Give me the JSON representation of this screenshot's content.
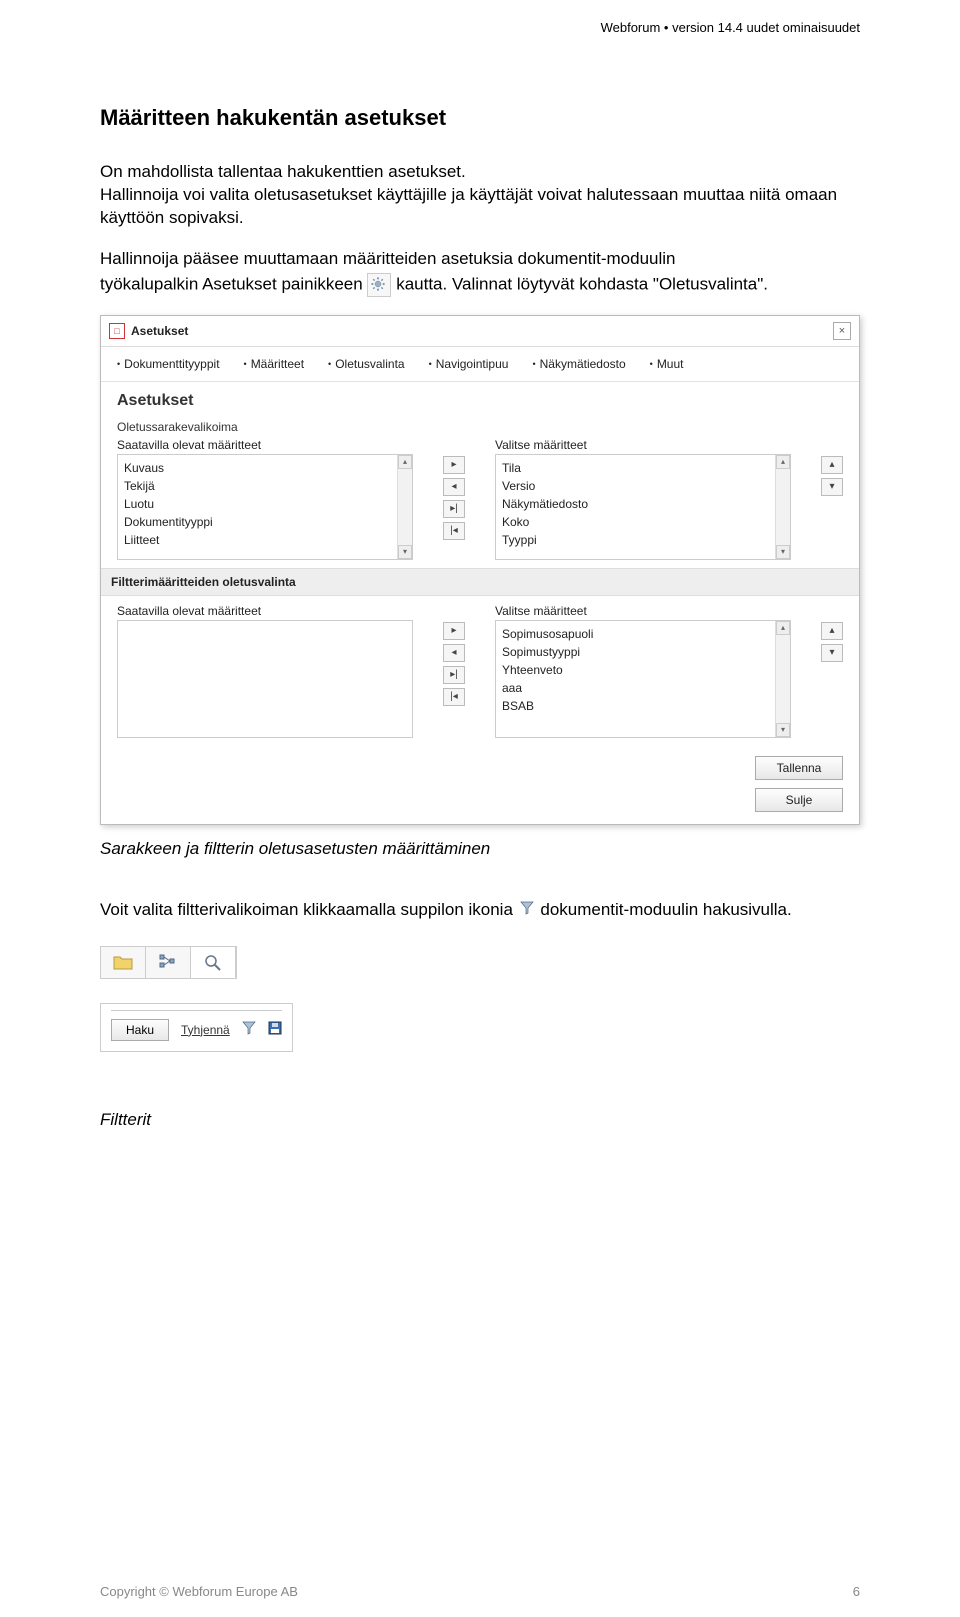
{
  "header": {
    "product_line": "Webforum • version 14.4 uudet ominaisuudet"
  },
  "section_title": "Määritteen hakukentän asetukset",
  "paragraphs": {
    "p1": "On mahdollista tallentaa hakukenttien asetukset.",
    "p2": "Hallinnoija voi valita oletusasetukset käyttäjille ja käyttäjät voivat halutessaan muuttaa niitä omaan käyttöön sopivaksi.",
    "p3_part1": "Hallinnoija pääsee muuttamaan määritteiden asetuksia dokumentit-moduulin",
    "p3_part2": "työkalupalkin Asetukset painikkeen ",
    "p3_part3": " kautta. Valinnat löytyvät kohdasta \"Oletusvalinta\"."
  },
  "dialog": {
    "title": "Asetukset",
    "close_x": "×",
    "tabs": [
      "Dokumenttityyppit",
      "Määritteet",
      "Oletusvalinta",
      "Navigointipuu",
      "Näkymätiedosto",
      "Muut"
    ],
    "heading": "Asetukset",
    "section1": {
      "group_label": "Oletussarakevalikoima",
      "left_head": "Saatavilla olevat määritteet",
      "right_head": "Valitse määritteet",
      "left_items": [
        "Kuvaus",
        "Tekijä",
        "Luotu",
        "Dokumentityyppi",
        "Liitteet"
      ],
      "right_items": [
        "Tila",
        "Versio",
        "Näkymätiedosto",
        "Koko",
        "Tyyppi"
      ]
    },
    "section2": {
      "band_label": "Filtterimääritteiden oletusvalinta",
      "left_head": "Saatavilla olevat määritteet",
      "right_head": "Valitse määritteet",
      "right_items": [
        "Sopimusosapuoli",
        "Sopimustyyppi",
        "Yhteenveto",
        "aaa",
        "BSAB"
      ]
    },
    "buttons": {
      "save": "Tallenna",
      "close": "Sulje"
    }
  },
  "caption1": "Sarakkeen ja filtterin oletusasetusten määrittäminen",
  "paragraphs2": {
    "p4_part1": "Voit valita filtterivalikoiman klikkaamalla suppilon ikonia ",
    "p4_part2": " dokumentit-moduulin hakusivulla."
  },
  "searchbar": {
    "search_btn": "Haku",
    "clear_link": "Tyhjennä"
  },
  "caption2": "Filtterit",
  "footer": {
    "copyright": "Copyright © Webforum Europe AB",
    "page": "6"
  }
}
